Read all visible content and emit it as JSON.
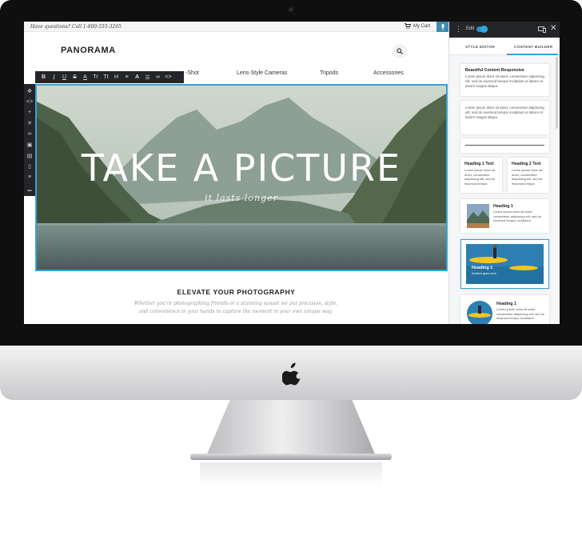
{
  "site": {
    "topbar": {
      "question": "Have questions? Call 1-800-555-3265",
      "cart": "My Cart"
    },
    "logo": "PANORAMA",
    "nav": [
      "-Shot",
      "Lens-Style Cameras",
      "Tripods",
      "Accessories"
    ],
    "toolbar": [
      "B",
      "I",
      "U",
      "S",
      "A",
      "Tr",
      "Tt",
      "H",
      "≡",
      "A",
      "☰",
      "∞",
      "<>"
    ],
    "left_tools": [
      "✥",
      "<>",
      "+",
      "✕",
      "∞",
      "▣",
      "▤",
      "▯",
      "≡",
      "▁"
    ],
    "hero": {
      "title": "TAKE A PICTURE",
      "subtitle": "it lasts longer"
    },
    "section_title": "ELEVATE YOUR PHOTOGRAPHY",
    "section_text": "Whether you're photographing friends or a stunning sunset we put precision, style, and convenience in your hands to capture the moment in your own unique way."
  },
  "panel": {
    "edit_label": "Edit",
    "tabs": [
      "STYLE EDITOR",
      "CONTENT BUILDER"
    ],
    "blocks": {
      "b1_title": "Beautiful Content Responsive",
      "lorem": "Lorem ipsum dolor sit amet, consectetur adipiscing elit, sed do eiusmod tempor incididunt ut labore et dolore magna aliqua.",
      "lorem_short": "Lorem ipsum dolor sit amet, consectetur adipiscing elit, sed do eiusmod tempor.",
      "lorem_mid": "Lorem ipsum dolor sit amet, consectetur adipiscing elit, sed do eiusmod tempor incididunt.",
      "heading1_text": "Heading 1 Text",
      "heading2_text": "Heading 2 Text",
      "heading1": "Heading 1",
      "overlay_sub": "Subtext goes here"
    }
  }
}
